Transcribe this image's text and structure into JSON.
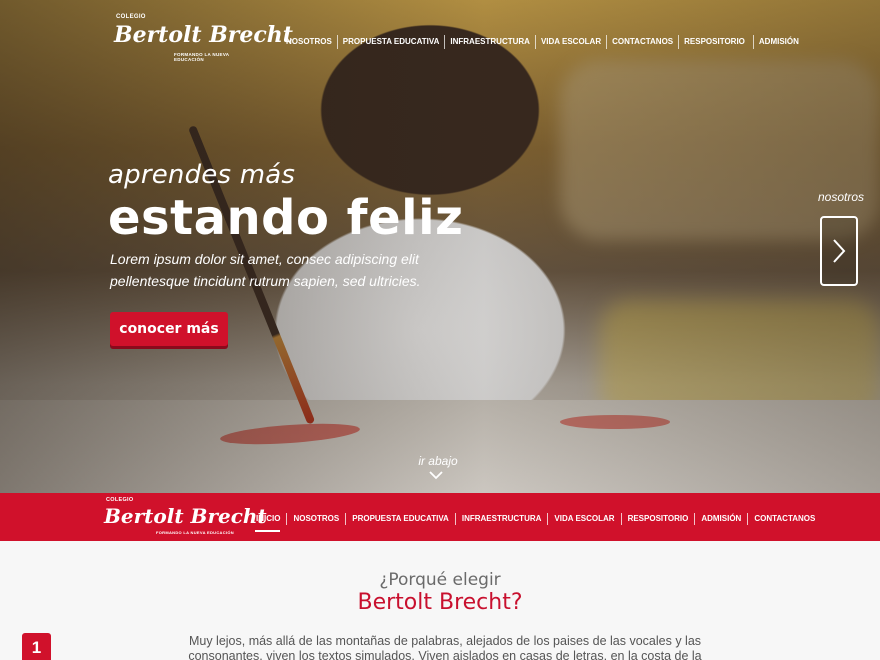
{
  "brand": {
    "colegio": "COLEGIO",
    "name": "Bertolt Brecht",
    "subtitle": "FORMANDO LA NUEVA EDUCACIÓN"
  },
  "top_nav": {
    "items": [
      "NOSOTROS",
      "PROPUESTA EDUCATIVA",
      "INFRAESTRUCTURA",
      "VIDA ESCOLAR",
      "CONTACTANOS",
      "RESPOSITORIO",
      "ADMISIÓN"
    ]
  },
  "hero": {
    "tagline_small": "aprendes más",
    "tagline_big": "estando feliz",
    "text": "Lorem ipsum dolor sit amet, consec adipiscing elit pellentesque tincidunt rutrum sapien, sed ultricies.",
    "cta_label": "conocer más",
    "side_label": "nosotros",
    "next_icon": "chevron-right-icon",
    "scroll_label": "ir abajo",
    "scroll_icon": "chevron-down-icon"
  },
  "red_nav": {
    "items": [
      "INICIO",
      "NOSOTROS",
      "PROPUESTA EDUCATIVA",
      "INFRAESTRUCTURA",
      "VIDA ESCOLAR",
      "RESPOSITORIO",
      "ADMISIÓN",
      "CONTACTANOS"
    ],
    "active": "INICIO"
  },
  "section": {
    "why_small": "¿Porqué elegir",
    "why_big": "Bertolt Brecht?",
    "badge": "1",
    "body": "Muy lejos, más allá de las montañas de palabras, alejados de los paises de las vocales y las consonantes, viven los textos simulados. Viven aislados en casas de letras, en la costa de la semántica, un"
  },
  "colors": {
    "accent": "#d0112b",
    "white": "#ffffff"
  }
}
